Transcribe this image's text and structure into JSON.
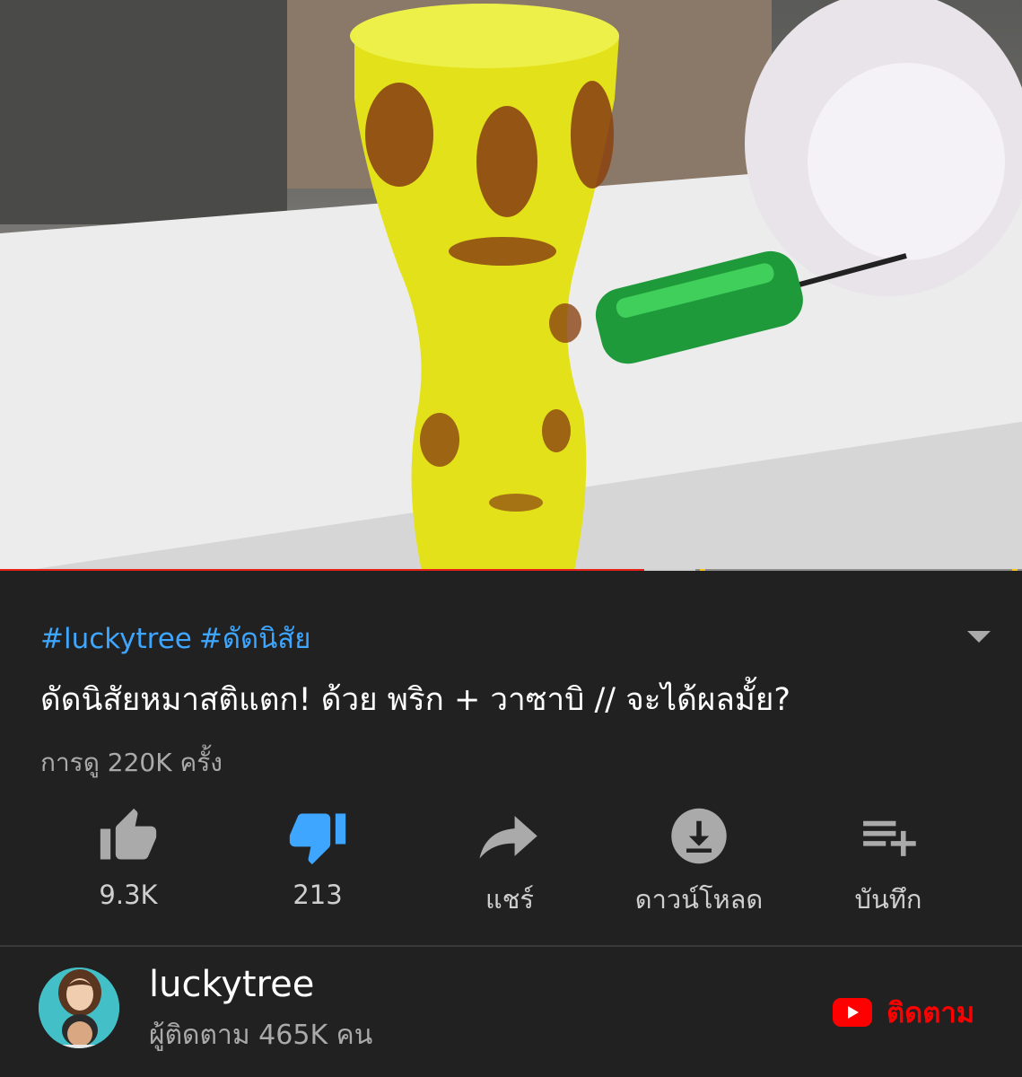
{
  "video": {
    "progress_played": 0.63,
    "progress_buffered": 0.68,
    "chapter_markers": [
      0.685,
      0.99
    ],
    "colors": {
      "played": "#e62117",
      "buffered": "#cfcfcf",
      "marker": "#f5c518"
    }
  },
  "info": {
    "hashtags": [
      "#luckytree",
      "#ดัดนิสัย"
    ],
    "title": "ดัดนิสัยหมาสติแตก! ด้วย พริก + วาซาบิ // จะได้ผลมั้ย?",
    "views": "การดู 220K ครั้ง",
    "expand_icon": "chevron-down-icon"
  },
  "actions": {
    "like": {
      "label": "9.3K",
      "icon": "thumbs-up-icon"
    },
    "dislike": {
      "label": "213",
      "icon": "thumbs-down-icon",
      "active": true,
      "color": "#3ea6ff"
    },
    "share": {
      "label": "แชร์",
      "icon": "share-icon"
    },
    "download": {
      "label": "ดาวน์โหลด",
      "icon": "download-icon"
    },
    "save": {
      "label": "บันทึก",
      "icon": "playlist-add-icon"
    }
  },
  "channel": {
    "name": "luckytree",
    "subscribers": "ผู้ติดตาม 465K คน",
    "subscribe_label": "ติดตาม",
    "subscribe_color": "#ff0000"
  }
}
